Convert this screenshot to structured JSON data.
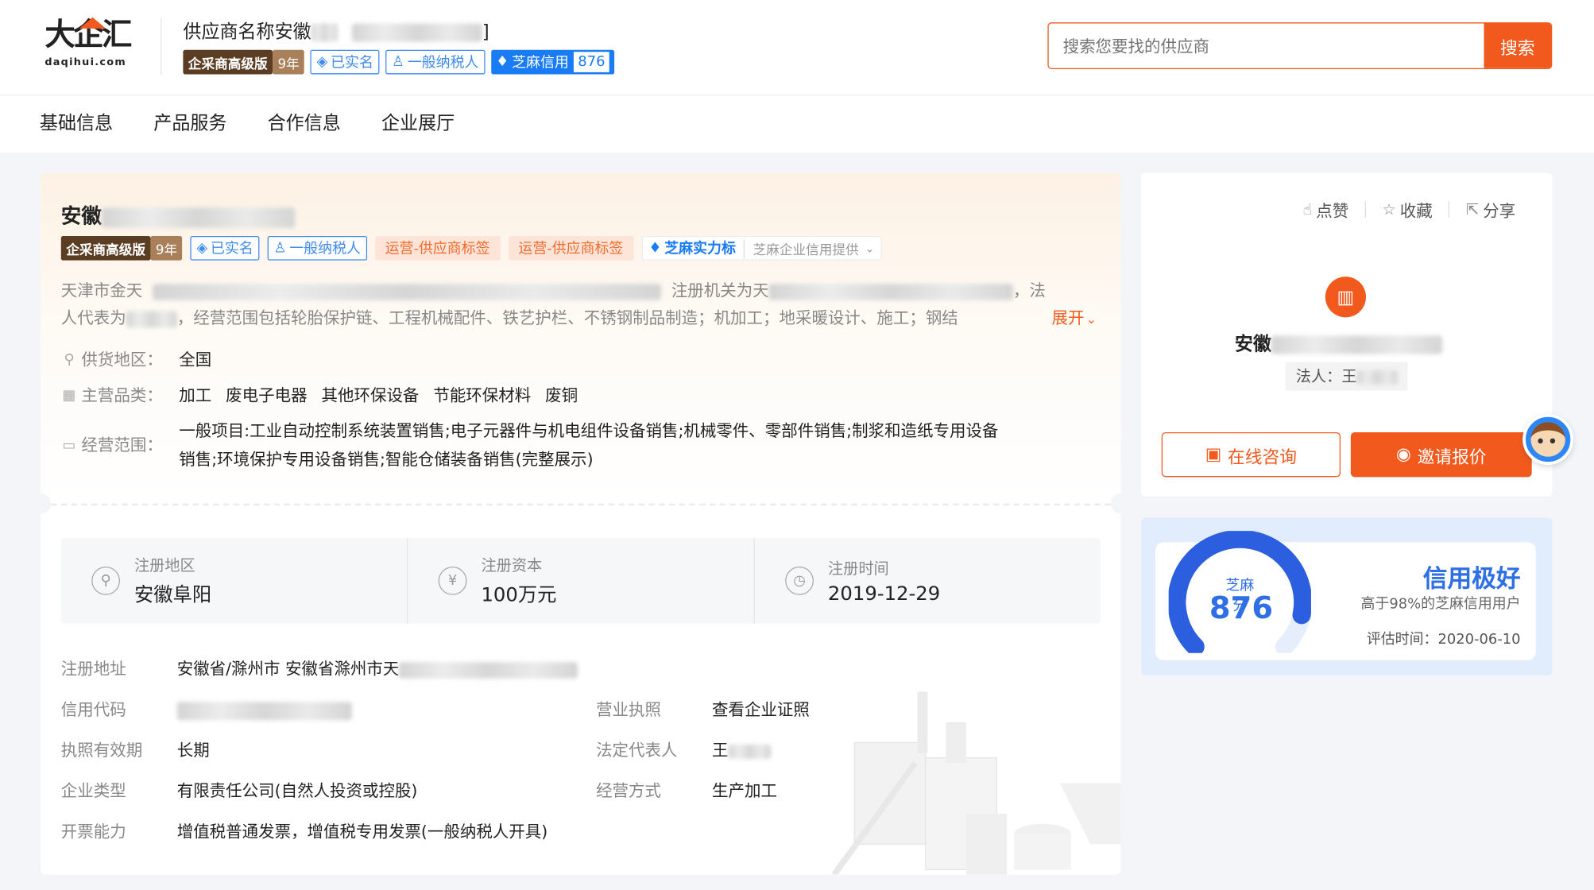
{
  "header": {
    "logo_text": "大企汇",
    "logo_domain": "daqihui.com",
    "supplier_name": "供应商名称安徽",
    "supplier_name_suffix": "]",
    "tags": {
      "vip": "企采商高级版",
      "years": "9年",
      "verified": "已实名",
      "taxpayer": "一般纳税人",
      "zhima": "芝麻信用",
      "zhima_score": "876"
    },
    "search_placeholder": "搜索您要找的供应商",
    "search_button": "搜索"
  },
  "nav": [
    "基础信息",
    "产品服务",
    "合作信息",
    "企业展厅"
  ],
  "company": {
    "title": "安徽",
    "tags": {
      "vip": "企采商高级版",
      "years": "9年",
      "verified": "已实名",
      "taxpayer": "一般纳税人",
      "op1": "运营-供应商标签",
      "op2": "运营-供应商标签",
      "zhima_strength": "芝麻实力标",
      "zhima_provider": "芝麻企业信用提供"
    },
    "intro_line1_a": "天津市金天",
    "intro_line1_b": "注册机关为天",
    "intro_line1_c": "，法",
    "intro_line2_a": "人代表为",
    "intro_line2_b": "，经营范围包括轮胎保护链、工程机械配件、铁艺护栏、不锈钢制品制造；机加工；地采暖设计、施工；钢结",
    "expand": "展开",
    "supply_area_label": "供货地区：",
    "supply_area": "全国",
    "main_cat_label": "主营品类：",
    "main_cats": [
      "加工",
      "废电子电器",
      "其他环保设备",
      "节能环保材料",
      "废铜"
    ],
    "scope_label": "经营范围：",
    "scope_line1": "一般项目:工业自动控制系统装置销售;电子元器件与机电组件设备销售;机械零件、零部件销售;制浆和造纸专用设备",
    "scope_line2": "销售;环境保护专用设备销售;智能仓储装备销售(完整展示)"
  },
  "stats": [
    {
      "label": "注册地区",
      "value": "安徽阜阳",
      "icon": "location-icon"
    },
    {
      "label": "注册资本",
      "value": "100万元",
      "icon": "yen-icon"
    },
    {
      "label": "注册时间",
      "value": "2019-12-29",
      "icon": "clock-icon"
    }
  ],
  "details": {
    "address_label": "注册地址",
    "address": "安徽省/滁州市 安徽省滁州市天",
    "credit_code_label": "信用代码",
    "license_label": "营业执照",
    "license_link": "查看企业证照",
    "validity_label": "执照有效期",
    "validity": "长期",
    "legal_rep_label": "法定代表人",
    "legal_rep": "王",
    "type_label": "企业类型",
    "type": "有限责任公司(自然人投资或控股)",
    "mode_label": "经营方式",
    "mode": "生产加工",
    "invoice_label": "开票能力",
    "invoice": "增值税普通发票，增值税专用发票(一般纳税人开具)"
  },
  "side": {
    "like": "点赞",
    "favorite": "收藏",
    "share": "分享",
    "company_name": "安徽",
    "legal_label": "法人：",
    "legal_value": "王",
    "consult": "在线咨询",
    "quote": "邀请报价"
  },
  "credit": {
    "label": "芝麻分",
    "score": 876,
    "score_text": "876",
    "level": "信用极好",
    "desc": "高于98%的芝麻信用用户",
    "eval_time": "评估时间：2020-06-10"
  },
  "colors": {
    "brand": "#f25a1d",
    "blue": "#2e6fe5",
    "link": "#2a6ddb"
  }
}
